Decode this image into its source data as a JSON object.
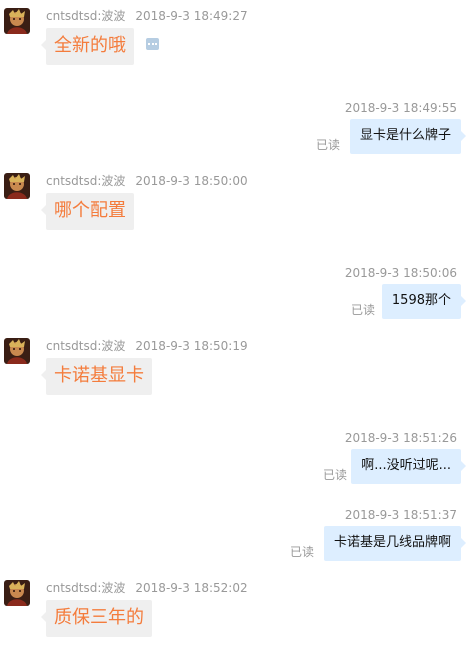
{
  "colors": {
    "incoming_text": "#f47c3c",
    "incoming_bubble": "#efefef",
    "outgoing_bubble": "#ddeeff",
    "meta_text": "#999999"
  },
  "read_label": "已读",
  "messages": [
    {
      "direction": "in",
      "sender": "cntsdtsd:波波",
      "time": "2018-9-3 18:49:27",
      "text": "全新的哦"
    },
    {
      "direction": "out",
      "time": "2018-9-3 18:49:55",
      "text": "显卡是什么牌子"
    },
    {
      "direction": "in",
      "sender": "cntsdtsd:波波",
      "time": "2018-9-3 18:50:00",
      "text": "哪个配置"
    },
    {
      "direction": "out",
      "time": "2018-9-3 18:50:06",
      "text": "1598那个"
    },
    {
      "direction": "in",
      "sender": "cntsdtsd:波波",
      "time": "2018-9-3 18:50:19",
      "text": "卡诺基显卡"
    },
    {
      "direction": "out",
      "time": "2018-9-3 18:51:26",
      "text": "啊...没听过呢..."
    },
    {
      "direction": "out",
      "time": "2018-9-3 18:51:37",
      "text": "卡诺基是几线品牌啊"
    },
    {
      "direction": "in",
      "sender": "cntsdtsd:波波",
      "time": "2018-9-3 18:52:02",
      "text": "质保三年的"
    }
  ]
}
